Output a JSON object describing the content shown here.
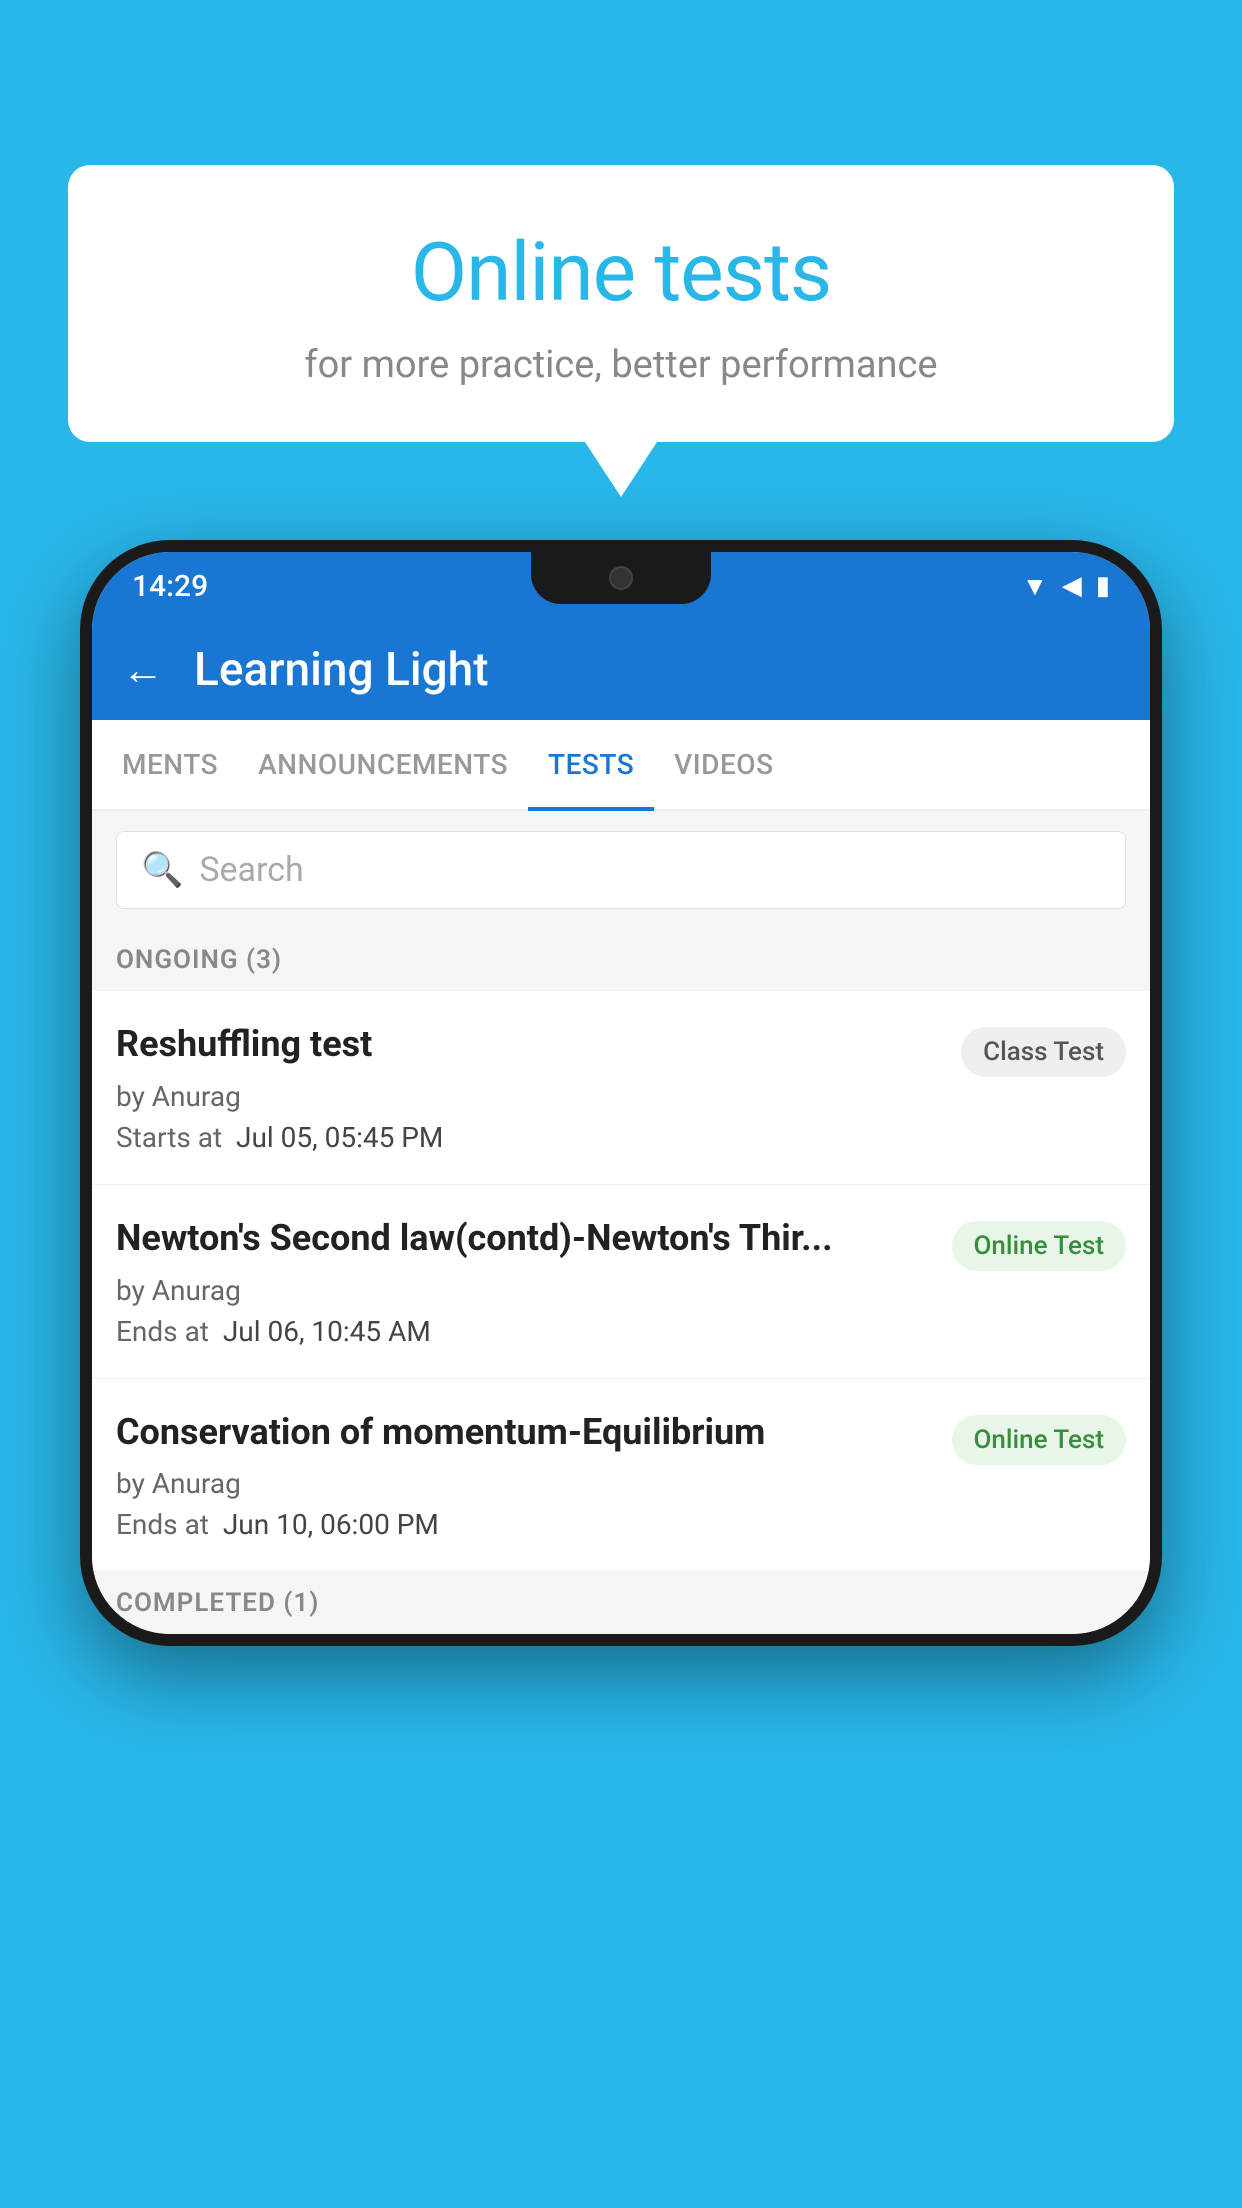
{
  "background": {
    "color": "#29b6e8"
  },
  "speech_bubble": {
    "title": "Online tests",
    "subtitle": "for more practice, better performance"
  },
  "status_bar": {
    "time": "14:29",
    "icons": [
      "▼",
      "◀",
      "▮"
    ]
  },
  "app_bar": {
    "back_label": "←",
    "title": "Learning Light"
  },
  "tabs": [
    {
      "label": "MENTS",
      "active": false
    },
    {
      "label": "ANNOUNCEMENTS",
      "active": false
    },
    {
      "label": "TESTS",
      "active": true
    },
    {
      "label": "VIDEOS",
      "active": false
    }
  ],
  "search": {
    "placeholder": "Search"
  },
  "ongoing_section": {
    "label": "ONGOING (3)"
  },
  "tests": [
    {
      "name": "Reshuffling test",
      "author": "by Anurag",
      "date_label": "Starts at",
      "date_value": "Jul 05, 05:45 PM",
      "badge": "Class Test",
      "badge_type": "class"
    },
    {
      "name": "Newton's Second law(contd)-Newton's Thir...",
      "author": "by Anurag",
      "date_label": "Ends at",
      "date_value": "Jul 06, 10:45 AM",
      "badge": "Online Test",
      "badge_type": "online"
    },
    {
      "name": "Conservation of momentum-Equilibrium",
      "author": "by Anurag",
      "date_label": "Ends at",
      "date_value": "Jun 10, 06:00 PM",
      "badge": "Online Test",
      "badge_type": "online"
    }
  ],
  "completed_section": {
    "label": "COMPLETED (1)"
  }
}
